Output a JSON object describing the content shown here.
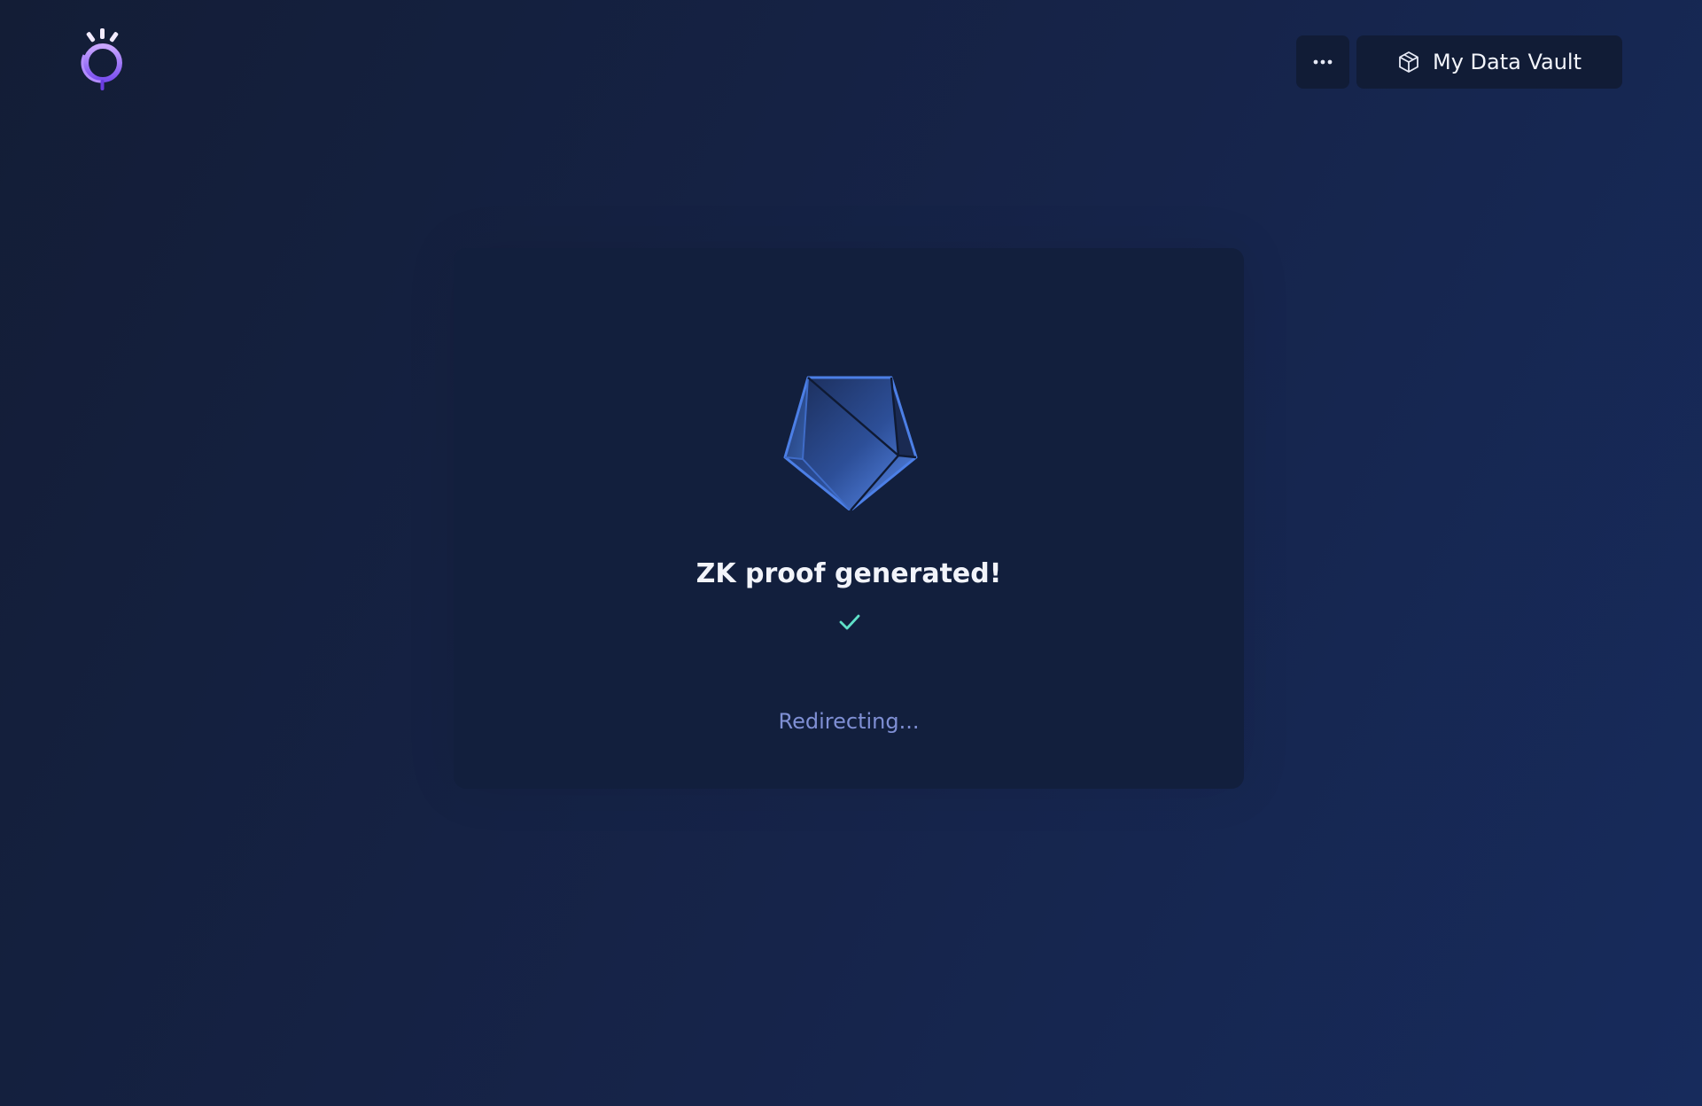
{
  "header": {
    "logo_icon": "eye-orb-icon",
    "more_icon": "ellipsis-icon",
    "vault_button": {
      "icon": "cube-icon",
      "label": "My Data Vault"
    }
  },
  "card": {
    "illustration": "pentagon-gem-icon",
    "title": "ZK proof generated!",
    "status_icon": "check-icon",
    "status_text": "Redirecting..."
  },
  "colors": {
    "background": "#131d36",
    "card": "#121f3d",
    "button": "#111c36",
    "logo_accent": "#a77bf0",
    "check": "#5fe0c8",
    "status_text": "#7f8fd4",
    "gem": "#4a7be0"
  }
}
